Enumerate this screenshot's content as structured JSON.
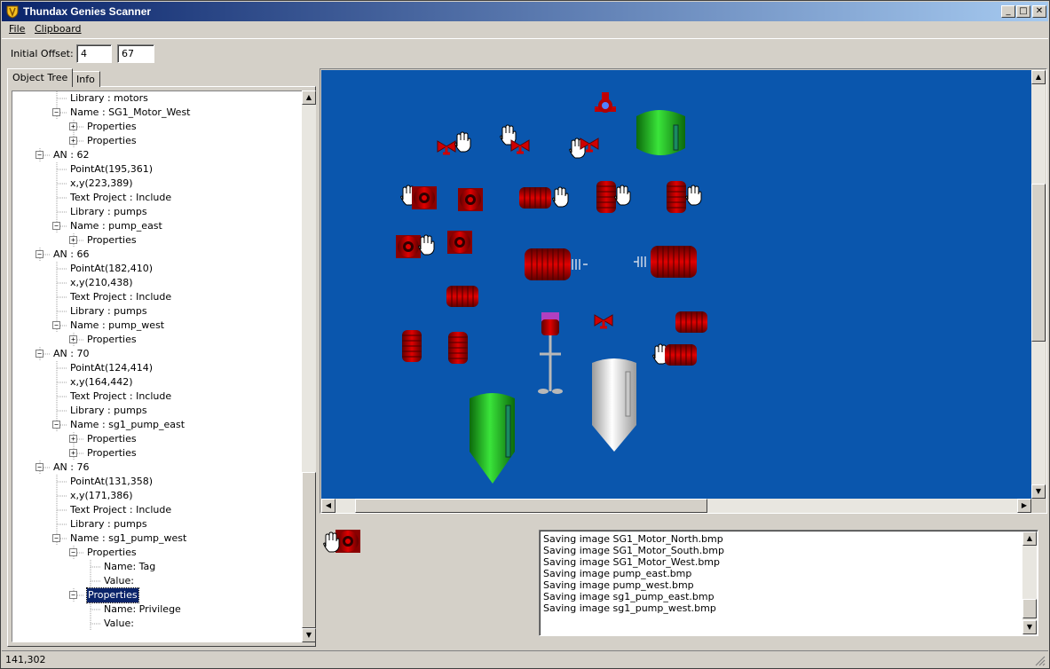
{
  "window": {
    "title": "Thundax Genies Scanner",
    "min_glyph": "_",
    "max_glyph": "□",
    "close_glyph": "✕"
  },
  "menu": {
    "file": "File",
    "clipboard": "Clipboard"
  },
  "toolbar": {
    "offset_label": "Initial Offset:",
    "offset_x": "4",
    "offset_y": "67"
  },
  "tabs": {
    "object_tree": "Object Tree",
    "info": "Info"
  },
  "tree": [
    {
      "label": "Library : motors",
      "depth": 2,
      "expander": ""
    },
    {
      "label": "Name : SG1_Motor_West",
      "depth": 2,
      "expander": "-"
    },
    {
      "label": "Properties",
      "depth": 3,
      "expander": "+"
    },
    {
      "label": "Properties",
      "depth": 3,
      "expander": "+"
    },
    {
      "label": "AN : 62",
      "depth": 1,
      "expander": "-"
    },
    {
      "label": "PointAt(195,361)",
      "depth": 2,
      "expander": ""
    },
    {
      "label": "x,y(223,389)",
      "depth": 2,
      "expander": ""
    },
    {
      "label": "Text Project : Include",
      "depth": 2,
      "expander": ""
    },
    {
      "label": "Library : pumps",
      "depth": 2,
      "expander": ""
    },
    {
      "label": "Name : pump_east",
      "depth": 2,
      "expander": "-"
    },
    {
      "label": "Properties",
      "depth": 3,
      "expander": "+"
    },
    {
      "label": "AN : 66",
      "depth": 1,
      "expander": "-"
    },
    {
      "label": "PointAt(182,410)",
      "depth": 2,
      "expander": ""
    },
    {
      "label": "x,y(210,438)",
      "depth": 2,
      "expander": ""
    },
    {
      "label": "Text Project : Include",
      "depth": 2,
      "expander": ""
    },
    {
      "label": "Library : pumps",
      "depth": 2,
      "expander": ""
    },
    {
      "label": "Name : pump_west",
      "depth": 2,
      "expander": "-"
    },
    {
      "label": "Properties",
      "depth": 3,
      "expander": "+"
    },
    {
      "label": "AN : 70",
      "depth": 1,
      "expander": "-"
    },
    {
      "label": "PointAt(124,414)",
      "depth": 2,
      "expander": ""
    },
    {
      "label": "x,y(164,442)",
      "depth": 2,
      "expander": ""
    },
    {
      "label": "Text Project : Include",
      "depth": 2,
      "expander": ""
    },
    {
      "label": "Library : pumps",
      "depth": 2,
      "expander": ""
    },
    {
      "label": "Name : sg1_pump_east",
      "depth": 2,
      "expander": "-"
    },
    {
      "label": "Properties",
      "depth": 3,
      "expander": "+"
    },
    {
      "label": "Properties",
      "depth": 3,
      "expander": "+"
    },
    {
      "label": "AN : 76",
      "depth": 1,
      "expander": "-"
    },
    {
      "label": "PointAt(131,358)",
      "depth": 2,
      "expander": ""
    },
    {
      "label": "x,y(171,386)",
      "depth": 2,
      "expander": ""
    },
    {
      "label": "Text Project : Include",
      "depth": 2,
      "expander": ""
    },
    {
      "label": "Library : pumps",
      "depth": 2,
      "expander": ""
    },
    {
      "label": "Name : sg1_pump_west",
      "depth": 2,
      "expander": "-"
    },
    {
      "label": "Properties",
      "depth": 3,
      "expander": "-"
    },
    {
      "label": "Name: Tag",
      "depth": 4,
      "expander": ""
    },
    {
      "label": "Value:",
      "depth": 4,
      "expander": ""
    },
    {
      "label": "Properties",
      "depth": 3,
      "expander": "-",
      "selected": true
    },
    {
      "label": "Name: Privilege",
      "depth": 4,
      "expander": ""
    },
    {
      "label": "Value:",
      "depth": 4,
      "expander": ""
    }
  ],
  "log": [
    "Saving image SG1_Motor_North.bmp",
    "Saving image SG1_Motor_South.bmp",
    "Saving image SG1_Motor_West.bmp",
    "Saving image pump_east.bmp",
    "Saving image pump_west.bmp",
    "Saving image sg1_pump_east.bmp",
    "Saving image sg1_pump_west.bmp"
  ],
  "status": {
    "coords": "141,302"
  },
  "colors": {
    "canvas_bg": "#0a56ad",
    "equipment_red": "#c00000",
    "tank_green": "#1db81d",
    "tank_white": "#e8e8e8",
    "selection": "#0a246a"
  }
}
